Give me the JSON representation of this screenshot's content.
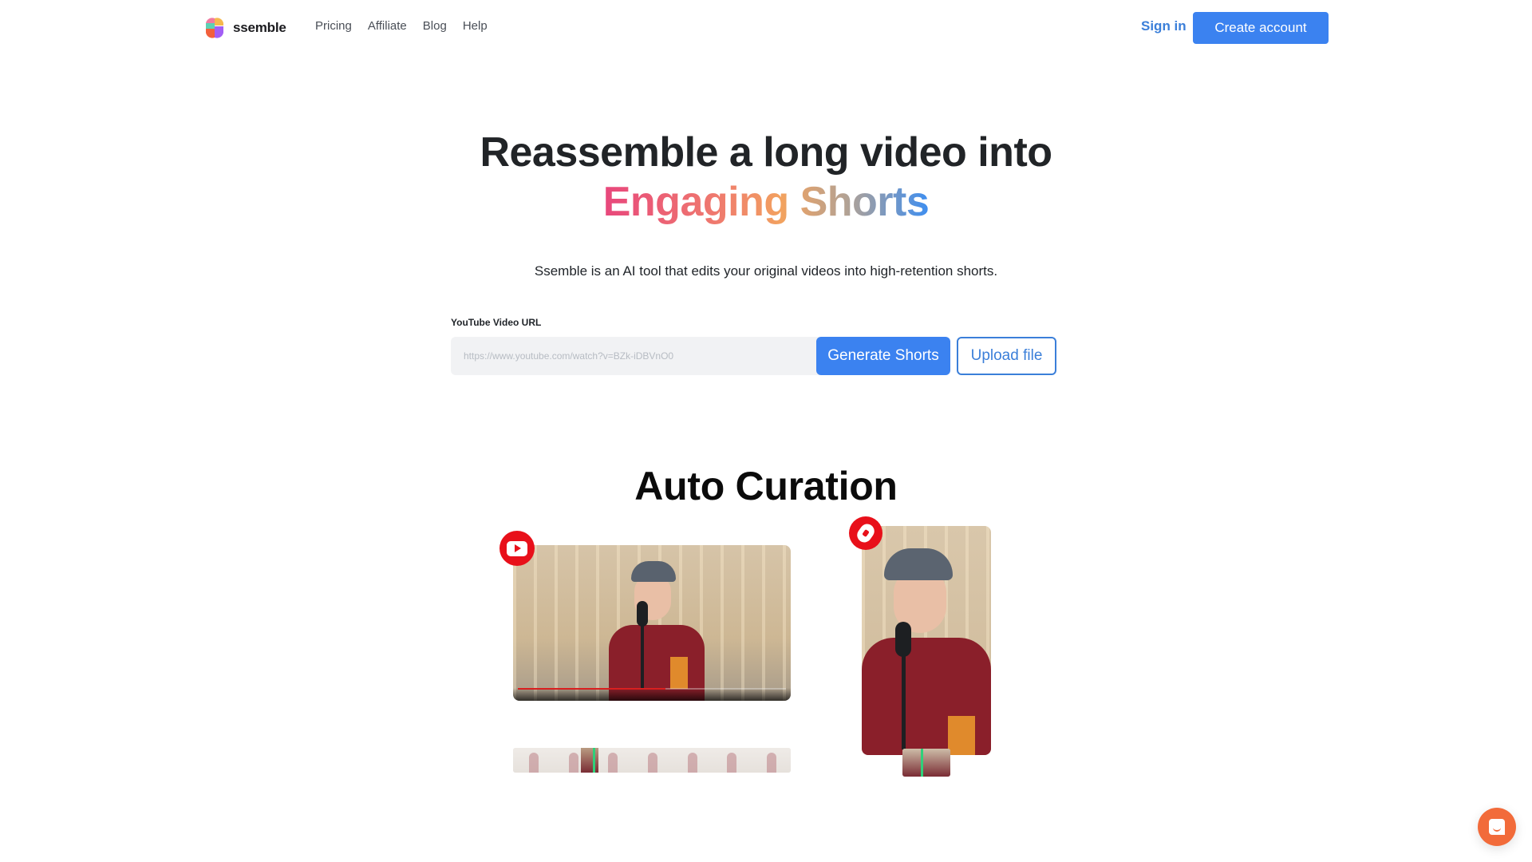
{
  "header": {
    "brand": "ssemble",
    "nav": [
      "Pricing",
      "Affiliate",
      "Blog",
      "Help"
    ],
    "sign_in": "Sign in",
    "create_account": "Create account"
  },
  "hero": {
    "title_line1": "Reassemble a long video into",
    "title_line2_word1": "Engaging",
    "title_line2_word2": "Shorts",
    "subtitle": "Ssemble is an AI tool that edits your original videos into high-retention shorts."
  },
  "form": {
    "label": "YouTube Video URL",
    "placeholder": "https://www.youtube.com/watch?v=BZk-iDBVnO0",
    "value": "",
    "generate_label": "Generate Shorts",
    "upload_label": "Upload file"
  },
  "section": {
    "title": "Auto Curation",
    "source_icon": "youtube-icon",
    "output_icon": "youtube-shorts-icon",
    "video_progress": 0.55
  },
  "colors": {
    "accent": "#3b82f0",
    "link": "#3b7fd9",
    "youtube_red": "#e8101a",
    "chat": "#f26b3a",
    "marker_green": "#2fd07a"
  },
  "chat": {
    "icon": "chat-icon"
  }
}
